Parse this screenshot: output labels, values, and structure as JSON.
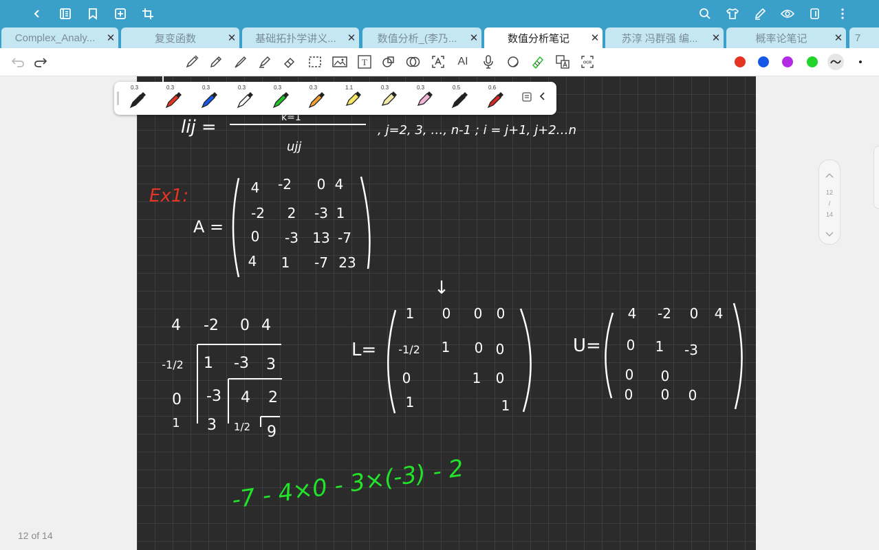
{
  "tabs": [
    {
      "label": "Complex_Analy...",
      "close": "✕"
    },
    {
      "label": "复变函数",
      "close": "✕"
    },
    {
      "label": "基础拓扑学讲义...",
      "close": "✕"
    },
    {
      "label": "数值分析_(李乃...",
      "close": "✕"
    },
    {
      "label": "数值分析笔记",
      "close": "✕"
    },
    {
      "label": "苏淳 冯群强 编...",
      "close": "✕"
    },
    {
      "label": "概率论笔记",
      "close": "✕"
    },
    {
      "label": "7"
    }
  ],
  "toolbar": {
    "text_tool": "T",
    "ai_tool": "AI",
    "ocr_tool": "OCR"
  },
  "colors": {
    "accent": "#3aa0c9",
    "red": "#e53424",
    "blue": "#1558e8",
    "purple": "#b42be6",
    "green": "#22d52a"
  },
  "pens": [
    {
      "size": "0.3",
      "icon": "fountain-pen",
      "color": "#222222"
    },
    {
      "size": "0.3",
      "icon": "fountain-pen",
      "color": "#e53424"
    },
    {
      "size": "0.3",
      "icon": "fountain-pen",
      "color": "#1558e8"
    },
    {
      "size": "0.3",
      "icon": "fountain-pen",
      "color": "#ffffff"
    },
    {
      "size": "0.3",
      "icon": "fountain-pen",
      "color": "#22c02a"
    },
    {
      "size": "0.3",
      "icon": "fountain-pen",
      "color": "#f0a030"
    },
    {
      "size": "1.1",
      "icon": "highlighter",
      "color": "#f5e663"
    },
    {
      "size": "0.3",
      "icon": "highlighter",
      "color": "#f3e9a6"
    },
    {
      "size": "0.3",
      "icon": "highlighter",
      "color": "#f0b6d8"
    },
    {
      "size": "0.5",
      "icon": "fountain-pen",
      "color": "#222222"
    },
    {
      "size": "0.6",
      "icon": "fountain-pen",
      "color": "#d42828"
    }
  ],
  "page_indicator": {
    "current": "12",
    "separator": "/",
    "total": "14"
  },
  "page_count": "12 of 14",
  "note": {
    "formula_lij": "lij =",
    "formula_k": "k=1",
    "formula_denominator": "ujj",
    "formula_range": ", j=2, 3, …, n-1 ;   i = j+1, j+2…n",
    "example_label": "Ex1:",
    "matrix_A_label": "A =",
    "matrix_A": [
      [
        "4",
        "-2",
        "0",
        "4"
      ],
      [
        "-2",
        "2",
        "-3",
        "1"
      ],
      [
        "0",
        "-3",
        "13",
        "-7"
      ],
      [
        "4",
        "1",
        "-7",
        "23"
      ]
    ],
    "down_arrow": "↓",
    "calc_header": [
      "4",
      "-2",
      "0",
      "4"
    ],
    "calc_col": [
      "-1/2",
      "0",
      "1"
    ],
    "calc_r1": [
      "1",
      "-3",
      "3"
    ],
    "calc_r2a": "-3",
    "calc_r2b": [
      "4",
      "2"
    ],
    "calc_r3a": "3",
    "calc_r3b": "1/2",
    "calc_r3c": "9",
    "L_label": "L=",
    "L_rows": [
      [
        "1",
        "0",
        "0",
        "0"
      ],
      [
        "-1/2",
        "1",
        "0",
        "0"
      ],
      [
        "0",
        "",
        "1",
        "0"
      ],
      [
        "1",
        "",
        "",
        "1"
      ]
    ],
    "U_label": "U=",
    "U_rows": [
      [
        "4",
        "-2",
        "0",
        "4"
      ],
      [
        "0",
        "1",
        "-3",
        ""
      ],
      [
        "0",
        "0",
        "",
        ""
      ],
      [
        "0",
        "0",
        "0",
        ""
      ]
    ],
    "green_expr": "-7 - 4×0 - 3×(-3) - 2"
  }
}
